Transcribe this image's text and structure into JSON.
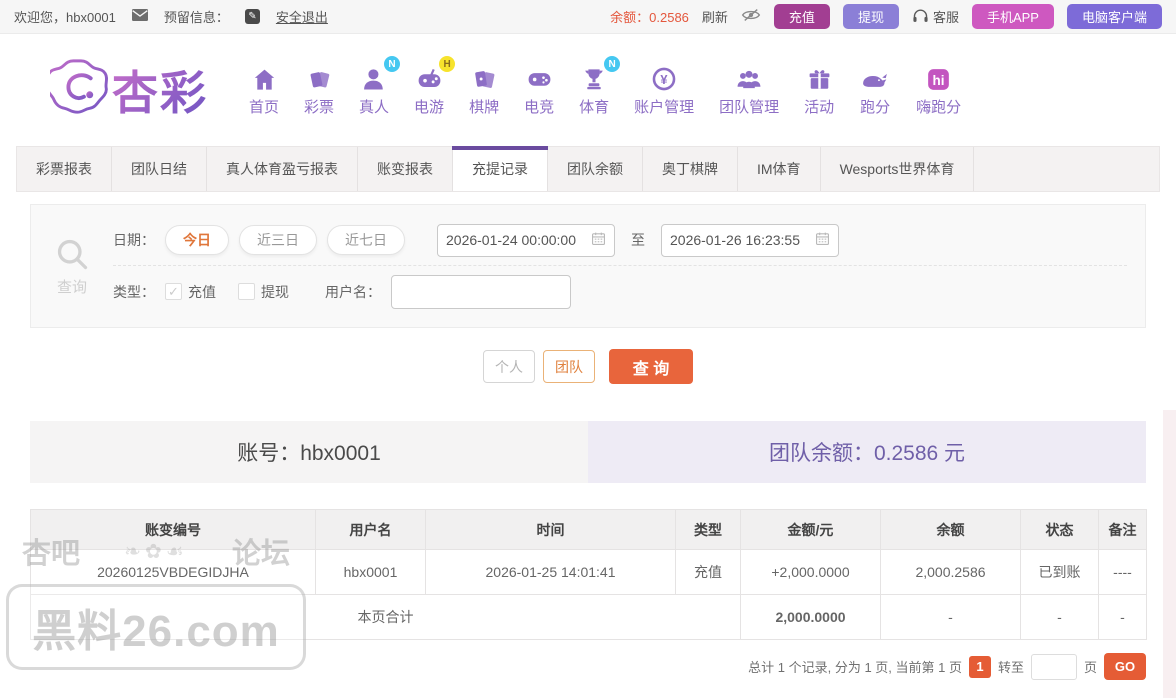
{
  "topbar": {
    "welcome": "欢迎您，hbx0001",
    "reserved_info_label": "预留信息：",
    "logout": "安全退出",
    "balance_label": "余额：",
    "balance_value": "0.2586",
    "refresh": "刷新",
    "recharge": "充值",
    "withdraw": "提现",
    "service": "客服",
    "mobile_app": "手机APP",
    "pc_client": "电脑客户端"
  },
  "brand": {
    "name": "杏彩"
  },
  "nav": {
    "items": [
      {
        "label": "首页"
      },
      {
        "label": "彩票"
      },
      {
        "label": "真人",
        "badge": "N"
      },
      {
        "label": "电游",
        "badge": "H"
      },
      {
        "label": "棋牌"
      },
      {
        "label": "电竞"
      },
      {
        "label": "体育",
        "badge": "N"
      },
      {
        "label": "账户管理"
      },
      {
        "label": "团队管理"
      },
      {
        "label": "活动"
      },
      {
        "label": "跑分"
      },
      {
        "label": "嗨跑分"
      }
    ]
  },
  "tabs": {
    "items": [
      "彩票报表",
      "团队日结",
      "真人体育盈亏报表",
      "账变报表",
      "充提记录",
      "团队余额",
      "奥丁棋牌",
      "IM体育",
      "Wesports世界体育"
    ],
    "active": "充提记录"
  },
  "filter": {
    "search_label": "查询",
    "date_label": "日期：",
    "presets": [
      "今日",
      "近三日",
      "近七日"
    ],
    "active_preset": "今日",
    "date_from": "2026-01-24 00:00:00",
    "to_label": "至",
    "date_to": "2026-01-26 16:23:55",
    "type_label": "类型：",
    "type_recharge": "充值",
    "type_recharge_checked": true,
    "type_withdraw": "提现",
    "type_withdraw_checked": false,
    "username_label": "用户名：",
    "username_value": ""
  },
  "actions": {
    "personal": "个人",
    "team": "团队",
    "query": "查 询"
  },
  "summary_bar": {
    "account": "账号：hbx0001",
    "team_balance": "团队余额：0.2586 元"
  },
  "table": {
    "headers": [
      "账变编号",
      "用户名",
      "时间",
      "类型",
      "金额/元",
      "余额",
      "状态",
      "备注"
    ],
    "rows": [
      [
        "20260125VBDEGIDJHA",
        "hbx0001",
        "2026-01-25 14:01:41",
        "充值",
        "+2,000.0000",
        "2,000.2586",
        "已到账",
        "----"
      ]
    ],
    "summary": {
      "label": "本页合计",
      "amount": "2,000.0000",
      "balance": "-",
      "status": "-",
      "note": "-"
    }
  },
  "pagination": {
    "info": "总计 1 个记录, 分为 1 页, 当前第 1 页",
    "current_page": "1",
    "goto_label": "转至",
    "goto_value": "",
    "page_unit": "页",
    "go": "GO"
  },
  "watermark": {
    "left": "杏吧",
    "right": "论坛",
    "site": "黑料26.com"
  },
  "colors": {
    "accent_orange": "#e8653c",
    "brand_purple": "#8d6ec5",
    "active_tab_purple": "#6a4b9f",
    "positive_green": "#72c04e",
    "balance_orange": "#e4573d",
    "team_balance_purple": "#6f5fa8",
    "btn_magenta": "#a23e92",
    "btn_periwinkle": "#8b7fd7",
    "btn_pink": "#ce58c0",
    "btn_violet": "#7d6bd8",
    "badge_blue": "#45c8f1",
    "badge_yellow": "#f7e32c"
  }
}
